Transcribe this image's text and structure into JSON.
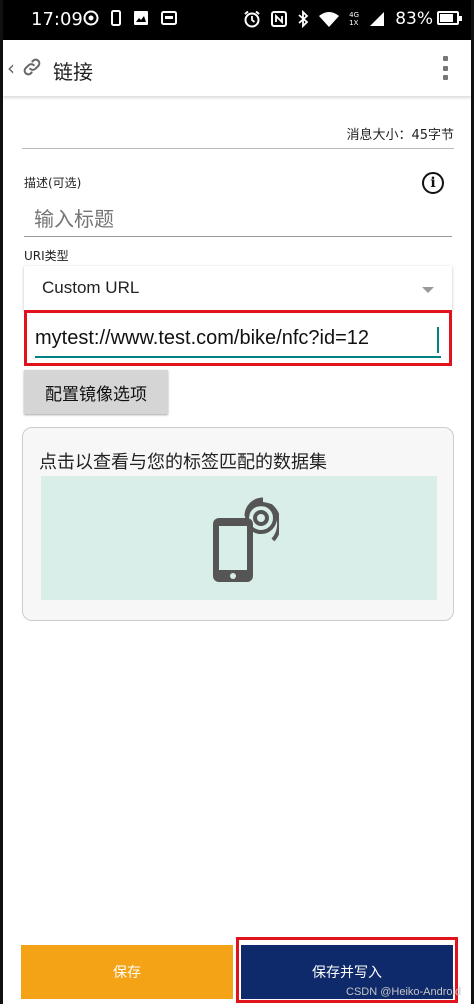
{
  "status_bar": {
    "time": "17:09",
    "battery": "83%",
    "network_top": "4G",
    "network_bottom": "1X"
  },
  "app_bar": {
    "title": "链接",
    "icons": [
      "back-chevron-icon",
      "link-icon",
      "more-vert-icon"
    ]
  },
  "message_size": "消息大小：45字节",
  "description": {
    "label": "描述(可选)",
    "placeholder": "输入标题",
    "value": ""
  },
  "uri_type": {
    "label": "URI类型",
    "selected": "Custom URL"
  },
  "url_field": {
    "value": "mytest://www.test.com/bike/nfc?id=12"
  },
  "mirror_button": "配置镜像选项",
  "dataset_card": {
    "text": "点击以查看与您的标签匹配的数据集"
  },
  "buttons": {
    "save": "保存",
    "save_and_write": "保存并写入"
  },
  "watermark": "CSDN @Heiko-Android",
  "colors": {
    "save_button": "#f5a316",
    "save_write_button": "#0f2a6a",
    "highlight_box": "#e0121b",
    "accent": "#008080"
  }
}
